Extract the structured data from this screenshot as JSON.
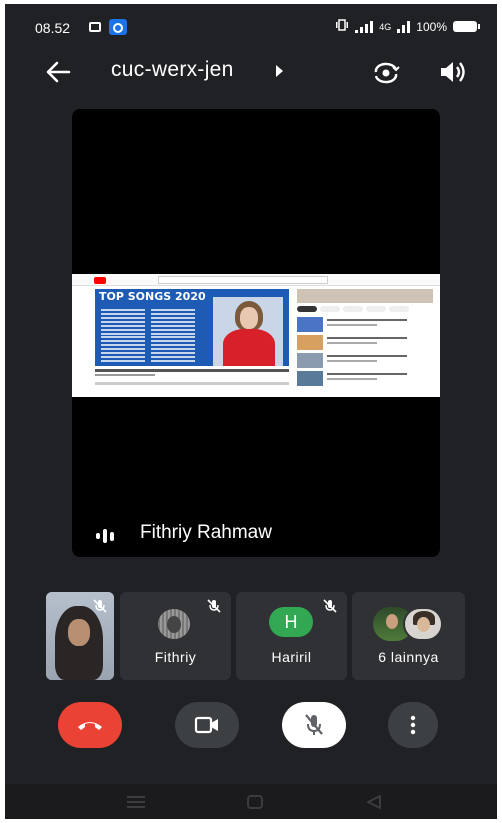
{
  "status_bar": {
    "time": "08.52",
    "network": "4G",
    "battery": "100%"
  },
  "header": {
    "meeting_code": "cuc-werx-jen"
  },
  "main_tile": {
    "presenter_name": "Fithriy Rahmaw",
    "shared_content": {
      "video_title_overlay": "TOP SONGS 2020"
    }
  },
  "participants": [
    {
      "name": "Fithriy",
      "muted": true
    },
    {
      "name": "Hariril",
      "avatar_letter": "H",
      "avatar_color": "#33a852",
      "muted": true
    },
    {
      "name": "6 lainnya"
    }
  ],
  "controls": {
    "end_call_color": "#ea4335"
  },
  "icons": [
    "back-arrow-icon",
    "switch-camera-icon",
    "speaker-icon",
    "mic-off-icon",
    "end-call-icon",
    "camera-icon",
    "more-vert-icon",
    "talking-indicator-icon"
  ]
}
